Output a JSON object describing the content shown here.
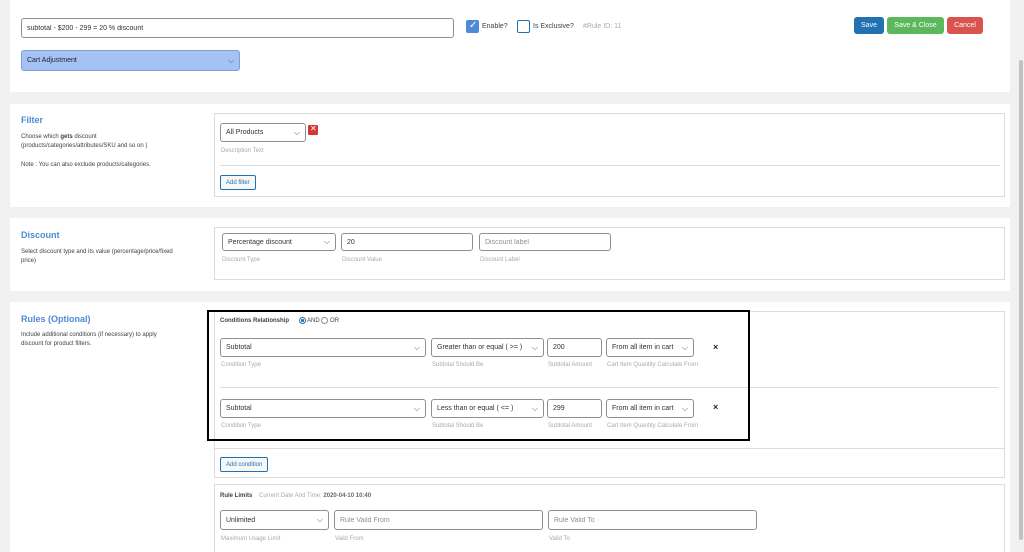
{
  "header": {
    "rule_title_value": "subtotal - $200 - 299 = 20 % discount",
    "enable_label": "Enable?",
    "enable_checked": true,
    "exclusive_label": "Is Exclusive?",
    "exclusive_checked": false,
    "rule_id_text": "#Rule ID: 11",
    "rule_type_value": "Cart Adjustment",
    "save_label": "Save",
    "save_close_label": "Save & Close",
    "cancel_label": "Cancel"
  },
  "filter": {
    "title": "Filter",
    "desc_pre": "Choose which ",
    "desc_bold": "gets",
    "desc_post": " discount",
    "desc_line2": "(products/categories/attributes/SKU and so on )",
    "note": "Note : You can also exclude products/categories.",
    "product_select": "All Products",
    "description_hint": "Description Text",
    "add_filter_label": "Add filter"
  },
  "discount": {
    "title": "Discount",
    "desc_line1": "Select discount type and its value (percentage/price/fixed",
    "desc_line2": "price)",
    "type_value": "Percentage discount",
    "type_hint": "Discount Type",
    "value": "20",
    "value_hint": "Discount Value",
    "label_placeholder": "Discount label",
    "label_hint": "Discount Label"
  },
  "rules": {
    "title": "Rules (Optional)",
    "desc_line1": "Include additional conditions (if necessary) to apply",
    "desc_line2": "discount for product filters.",
    "relationship_label": "Conditions Relationship",
    "and_label": "AND",
    "or_label": "OR",
    "conditions": [
      {
        "type": "Subtotal",
        "type_hint": "Condition Type",
        "operator": "Greater than or equal ( >= )",
        "operator_hint": "Subtotal Should Be",
        "amount": "200",
        "amount_hint": "Subtotal Amount",
        "calc": "From all item in cart",
        "calc_hint": "Cart Item Quantity Calculate From",
        "remove_label": "×"
      },
      {
        "type": "Subtotal",
        "type_hint": "Condition Type",
        "operator": "Less than or equal ( <= )",
        "operator_hint": "Subtotal Should Be",
        "amount": "299",
        "amount_hint": "Subtotal Amount",
        "calc": "From all item in cart",
        "calc_hint": "Cart Item Quantity Calculate From",
        "remove_label": "×"
      }
    ],
    "add_condition_label": "Add condition"
  },
  "limits": {
    "title": "Rule Limits",
    "current_label": "Current Date And Time:",
    "current_value": "2020-04-10 10:40",
    "usage_value": "Unlimited",
    "usage_hint": "Maximum Usage Limit",
    "from_placeholder": "Rule Vaild From",
    "from_hint": "Vaild From",
    "to_placeholder": "Rule Valid To",
    "to_hint": "Valid To"
  },
  "icons": {
    "chevron": "⌵",
    "check": "✓",
    "remove": "✕"
  },
  "colors": {
    "save": "#2271b1",
    "save_close": "#5cb85c",
    "cancel": "#d9534f",
    "rule_type_bg": "#a6c1f4",
    "title_blue": "#4f8ad6",
    "highlight_box": "#000000"
  }
}
